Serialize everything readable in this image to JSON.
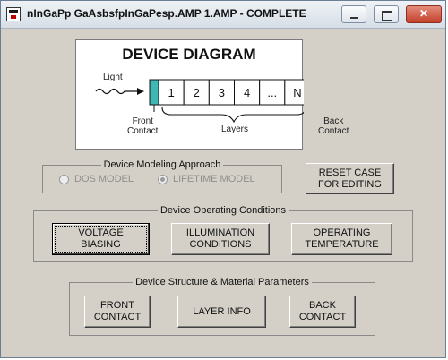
{
  "window": {
    "title": "nInGaPp GaAsbsfpInGaPesp.AMP 1.AMP - COMPLETE",
    "controls": {
      "minimize": "",
      "maximize": "",
      "close": "✕"
    }
  },
  "diagram": {
    "title": "DEVICE DIAGRAM",
    "light_label": "Light",
    "cells": [
      "1",
      "2",
      "3",
      "4",
      "...",
      "N"
    ],
    "front_label": "Front\nContact",
    "back_label": "Back\nContact",
    "layers_label": "Layers",
    "colors": {
      "front_contact": "#3fb8b4",
      "back_contact": "#2a3f9a"
    }
  },
  "modeling": {
    "legend": "Device Modeling Approach",
    "options": [
      {
        "label": "DOS MODEL",
        "selected": false
      },
      {
        "label": "LIFETIME MODEL",
        "selected": true
      }
    ],
    "enabled": false
  },
  "reset_button": "RESET CASE\nFOR EDITING",
  "operating": {
    "legend": "Device Operating Conditions",
    "buttons": [
      "VOLTAGE\nBIASING",
      "ILLUMINATION\nCONDITIONS",
      "OPERATING\nTEMPERATURE"
    ]
  },
  "structure": {
    "legend": "Device Structure & Material Parameters",
    "buttons": [
      "FRONT\nCONTACT",
      "LAYER INFO",
      "BACK\nCONTACT"
    ]
  }
}
